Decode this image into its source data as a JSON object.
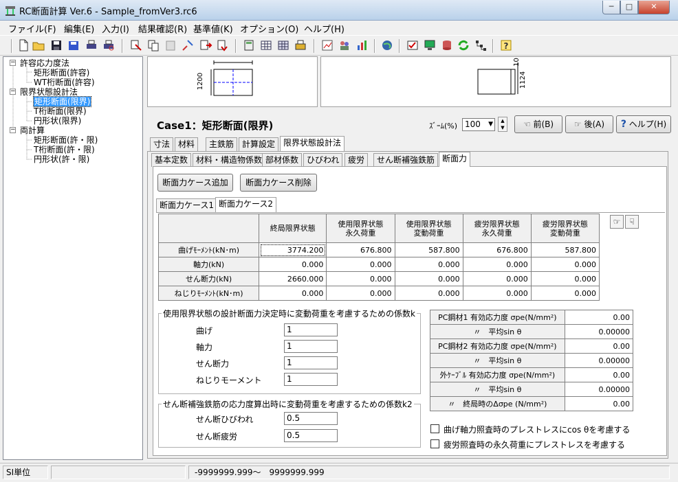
{
  "window": {
    "title": "RC断面計算 Ver.6 - Sample_fromVer3.rc6"
  },
  "menu": [
    "ファイル(F)",
    "編集(E)",
    "入力(I)",
    "結果確認(R)",
    "基準値(K)",
    "オプション(O)",
    "ヘルプ(H)"
  ],
  "tree": {
    "group1": {
      "label": "許容応力度法",
      "items": [
        "矩形断面(許容)",
        "WT桁断面(許容)"
      ]
    },
    "group2": {
      "label": "限界状態設計法",
      "items": [
        "矩形断面(限界)",
        "T桁断面(限界)",
        "円形状(限界)"
      ]
    },
    "group3": {
      "label": "両計算",
      "items": [
        "矩形断面(許・限)",
        "T桁断面(許・限)",
        "円形状(許・限)"
      ]
    }
  },
  "preview": {
    "left_dim": "1200",
    "right_dim": "1124",
    "right_top_dim": "10"
  },
  "header": {
    "case_title": "Case1：矩形断面(限界)",
    "zoom_label": "ｽﾞｰﾑ(%)",
    "zoom_value": "100",
    "prev_label": "前(B)",
    "next_label": "後(A)",
    "help_label": "ヘルプ(H)"
  },
  "tabs_top": [
    "寸法",
    "材料",
    "主鉄筋",
    "計算設定",
    "限界状態設計法"
  ],
  "tabs_sub": [
    "基本定数",
    "材料・構造物係数",
    "部材係数",
    "ひびわれ",
    "疲労",
    "せん断補強鉄筋",
    "断面力"
  ],
  "buttons": {
    "add_case": "断面力ケース追加",
    "delete_case": "断面力ケース削除"
  },
  "case_tabs": [
    "断面力ケース1",
    "断面力ケース2"
  ],
  "force_table": {
    "headers": [
      "終局限界状態",
      "使用限界状態\n永久荷重",
      "使用限界状態\n変動荷重",
      "疲労限界状態\n永久荷重",
      "疲労限界状態\n変動荷重"
    ],
    "rows": [
      {
        "label": "曲げﾓｰﾒﾝﾄ(kN･m)",
        "values": [
          "3774.200",
          "676.800",
          "587.800",
          "676.800",
          "587.800"
        ]
      },
      {
        "label": "軸力(kN)",
        "values": [
          "0.000",
          "0.000",
          "0.000",
          "0.000",
          "0.000"
        ]
      },
      {
        "label": "せん断力(kN)",
        "values": [
          "2660.000",
          "0.000",
          "0.000",
          "0.000",
          "0.000"
        ]
      },
      {
        "label": "ねじりﾓｰﾒﾝﾄ(kN･m)",
        "values": [
          "0.000",
          "0.000",
          "0.000",
          "0.000",
          "0.000"
        ]
      }
    ]
  },
  "coeff_k": {
    "title": "使用限界状態の設計断面力決定時に変動荷重を考慮するための係数k",
    "items": [
      {
        "label": "曲げ",
        "value": "1"
      },
      {
        "label": "軸力",
        "value": "1"
      },
      {
        "label": "せん断力",
        "value": "1"
      },
      {
        "label": "ねじりモーメント",
        "value": "1"
      }
    ]
  },
  "coeff_k2": {
    "title": "せん断補強鉄筋の応力度算出時に変動荷重を考慮するための係数k2",
    "items": [
      {
        "label": "せん断ひびわれ",
        "value": "0.5"
      },
      {
        "label": "せん断疲労",
        "value": "0.5"
      }
    ]
  },
  "pc_table": {
    "rows": [
      {
        "label": "PC鋼材1 有効応力度 σpe(N/mm²)",
        "value": "0.00"
      },
      {
        "label": "〃　平均sin θ",
        "value": "0.00000"
      },
      {
        "label": "PC鋼材2 有効応力度 σpe(N/mm²)",
        "value": "0.00"
      },
      {
        "label": "〃　平均sin θ",
        "value": "0.00000"
      },
      {
        "label": "外ｹｰﾌﾞﾙ 有効応力度 σpe(N/mm²)",
        "value": "0.00"
      },
      {
        "label": "〃　平均sin θ",
        "value": "0.00000"
      },
      {
        "label": "〃　終局時のΔσpe (N/mm²)",
        "value": "0.00"
      }
    ]
  },
  "checks": [
    "曲げ軸力照査時のプレストレスにcos θを考慮する",
    "疲労照査時の永久荷重にプレストレスを考慮する"
  ],
  "status": {
    "units": "SI単位",
    "range": "-9999999.999～　9999999.999"
  }
}
